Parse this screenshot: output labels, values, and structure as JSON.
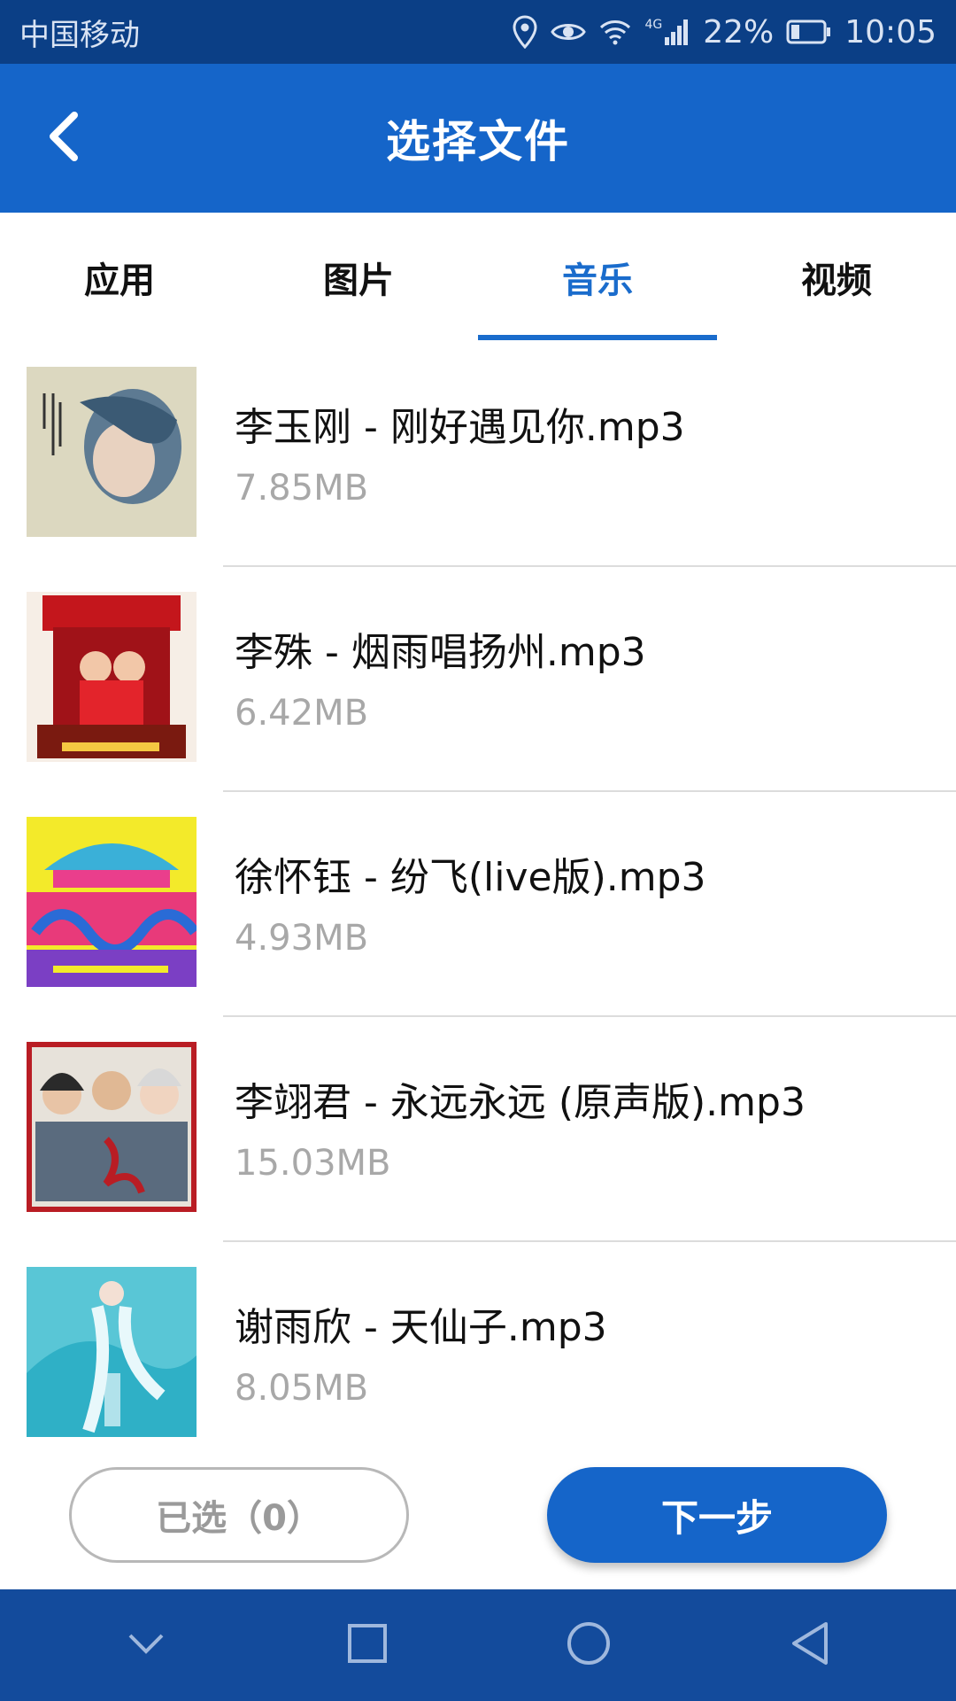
{
  "status_bar": {
    "carrier": "中国移动",
    "network": "4G",
    "battery": "22%",
    "time": "10:05"
  },
  "header": {
    "title": "选择文件",
    "back_icon": "chevron-left-icon"
  },
  "tabs": [
    {
      "label": "应用",
      "active": false
    },
    {
      "label": "图片",
      "active": false
    },
    {
      "label": "音乐",
      "active": true
    },
    {
      "label": "视频",
      "active": false
    }
  ],
  "files": [
    {
      "name": "李玉刚 - 刚好遇见你.mp3",
      "size": "7.85MB"
    },
    {
      "name": "李殊 - 烟雨唱扬州.mp3",
      "size": "6.42MB"
    },
    {
      "name": "徐怀钰 - 纷飞(live版).mp3",
      "size": "4.93MB"
    },
    {
      "name": "李翊君 - 永远永远 (原声版).mp3",
      "size": "15.03MB"
    },
    {
      "name": "谢雨欣 - 天仙子.mp3",
      "size": "8.05MB"
    }
  ],
  "footer": {
    "selected_label": "已选（0）",
    "next_label": "下一步"
  },
  "colors": {
    "status_bar": "#0b3f86",
    "primary": "#1565c9",
    "active_tab": "#1a6ccc"
  }
}
